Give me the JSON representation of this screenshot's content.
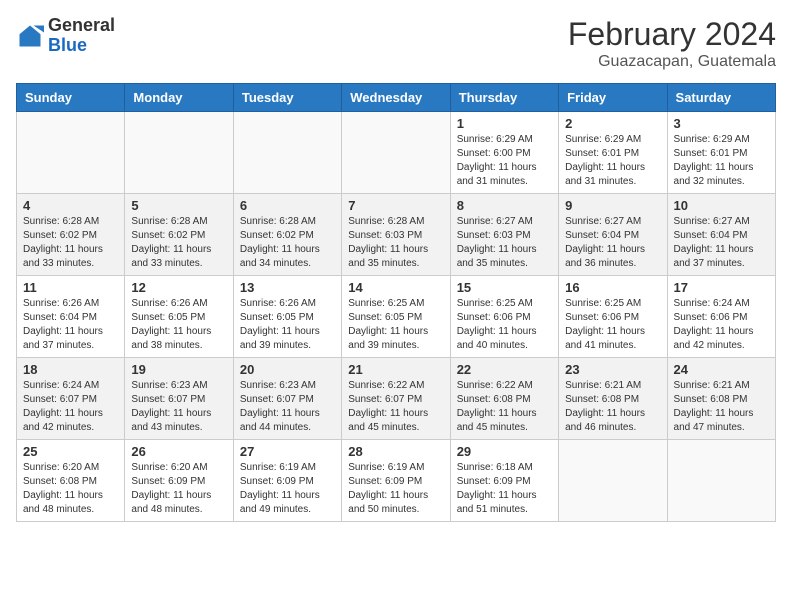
{
  "header": {
    "logo_general": "General",
    "logo_blue": "Blue",
    "month_year": "February 2024",
    "location": "Guazacapan, Guatemala"
  },
  "days_of_week": [
    "Sunday",
    "Monday",
    "Tuesday",
    "Wednesday",
    "Thursday",
    "Friday",
    "Saturday"
  ],
  "weeks": [
    [
      {
        "day": "",
        "info": ""
      },
      {
        "day": "",
        "info": ""
      },
      {
        "day": "",
        "info": ""
      },
      {
        "day": "",
        "info": ""
      },
      {
        "day": "1",
        "info": "Sunrise: 6:29 AM\nSunset: 6:00 PM\nDaylight: 11 hours and 31 minutes."
      },
      {
        "day": "2",
        "info": "Sunrise: 6:29 AM\nSunset: 6:01 PM\nDaylight: 11 hours and 31 minutes."
      },
      {
        "day": "3",
        "info": "Sunrise: 6:29 AM\nSunset: 6:01 PM\nDaylight: 11 hours and 32 minutes."
      }
    ],
    [
      {
        "day": "4",
        "info": "Sunrise: 6:28 AM\nSunset: 6:02 PM\nDaylight: 11 hours and 33 minutes."
      },
      {
        "day": "5",
        "info": "Sunrise: 6:28 AM\nSunset: 6:02 PM\nDaylight: 11 hours and 33 minutes."
      },
      {
        "day": "6",
        "info": "Sunrise: 6:28 AM\nSunset: 6:02 PM\nDaylight: 11 hours and 34 minutes."
      },
      {
        "day": "7",
        "info": "Sunrise: 6:28 AM\nSunset: 6:03 PM\nDaylight: 11 hours and 35 minutes."
      },
      {
        "day": "8",
        "info": "Sunrise: 6:27 AM\nSunset: 6:03 PM\nDaylight: 11 hours and 35 minutes."
      },
      {
        "day": "9",
        "info": "Sunrise: 6:27 AM\nSunset: 6:04 PM\nDaylight: 11 hours and 36 minutes."
      },
      {
        "day": "10",
        "info": "Sunrise: 6:27 AM\nSunset: 6:04 PM\nDaylight: 11 hours and 37 minutes."
      }
    ],
    [
      {
        "day": "11",
        "info": "Sunrise: 6:26 AM\nSunset: 6:04 PM\nDaylight: 11 hours and 37 minutes."
      },
      {
        "day": "12",
        "info": "Sunrise: 6:26 AM\nSunset: 6:05 PM\nDaylight: 11 hours and 38 minutes."
      },
      {
        "day": "13",
        "info": "Sunrise: 6:26 AM\nSunset: 6:05 PM\nDaylight: 11 hours and 39 minutes."
      },
      {
        "day": "14",
        "info": "Sunrise: 6:25 AM\nSunset: 6:05 PM\nDaylight: 11 hours and 39 minutes."
      },
      {
        "day": "15",
        "info": "Sunrise: 6:25 AM\nSunset: 6:06 PM\nDaylight: 11 hours and 40 minutes."
      },
      {
        "day": "16",
        "info": "Sunrise: 6:25 AM\nSunset: 6:06 PM\nDaylight: 11 hours and 41 minutes."
      },
      {
        "day": "17",
        "info": "Sunrise: 6:24 AM\nSunset: 6:06 PM\nDaylight: 11 hours and 42 minutes."
      }
    ],
    [
      {
        "day": "18",
        "info": "Sunrise: 6:24 AM\nSunset: 6:07 PM\nDaylight: 11 hours and 42 minutes."
      },
      {
        "day": "19",
        "info": "Sunrise: 6:23 AM\nSunset: 6:07 PM\nDaylight: 11 hours and 43 minutes."
      },
      {
        "day": "20",
        "info": "Sunrise: 6:23 AM\nSunset: 6:07 PM\nDaylight: 11 hours and 44 minutes."
      },
      {
        "day": "21",
        "info": "Sunrise: 6:22 AM\nSunset: 6:07 PM\nDaylight: 11 hours and 45 minutes."
      },
      {
        "day": "22",
        "info": "Sunrise: 6:22 AM\nSunset: 6:08 PM\nDaylight: 11 hours and 45 minutes."
      },
      {
        "day": "23",
        "info": "Sunrise: 6:21 AM\nSunset: 6:08 PM\nDaylight: 11 hours and 46 minutes."
      },
      {
        "day": "24",
        "info": "Sunrise: 6:21 AM\nSunset: 6:08 PM\nDaylight: 11 hours and 47 minutes."
      }
    ],
    [
      {
        "day": "25",
        "info": "Sunrise: 6:20 AM\nSunset: 6:08 PM\nDaylight: 11 hours and 48 minutes."
      },
      {
        "day": "26",
        "info": "Sunrise: 6:20 AM\nSunset: 6:09 PM\nDaylight: 11 hours and 48 minutes."
      },
      {
        "day": "27",
        "info": "Sunrise: 6:19 AM\nSunset: 6:09 PM\nDaylight: 11 hours and 49 minutes."
      },
      {
        "day": "28",
        "info": "Sunrise: 6:19 AM\nSunset: 6:09 PM\nDaylight: 11 hours and 50 minutes."
      },
      {
        "day": "29",
        "info": "Sunrise: 6:18 AM\nSunset: 6:09 PM\nDaylight: 11 hours and 51 minutes."
      },
      {
        "day": "",
        "info": ""
      },
      {
        "day": "",
        "info": ""
      }
    ]
  ]
}
